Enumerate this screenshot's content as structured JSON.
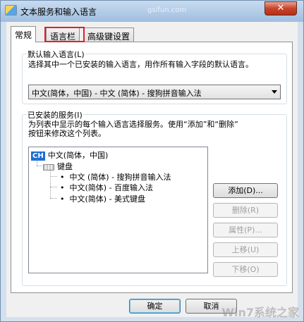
{
  "window": {
    "title": "文本服务和输入语言",
    "watermark_top": "gsifun.com",
    "close_symbol": "✕"
  },
  "tabs": [
    {
      "label": "常规",
      "active": true
    },
    {
      "label": "语言栏",
      "active": false,
      "highlighted": true
    },
    {
      "label": "高级键设置",
      "active": false
    }
  ],
  "default_language": {
    "title": "默认输入语言(L)",
    "description": "选择其中一个已安装的输入语言，用作所有输入字段的默认语言。",
    "selected": "中文(简体，中国) - 中文 (简体) - 搜狗拼音输入法"
  },
  "installed_services": {
    "title": "已安装的服务(I)",
    "description_line1": "为列表中显示的每个输入语言选择服务。使用“添加”和“删除”",
    "description_line2": "按钮来修改这个列表。",
    "language_badge": "CH",
    "language": "中文(简体，中国)",
    "category": "键盘",
    "items": [
      "中文 (简体) - 搜狗拼音输入法",
      "中文(简体) - 百度输入法",
      "中文(简体) - 美式键盘"
    ],
    "bullet": "•"
  },
  "side_buttons": {
    "add": "添加(D)...",
    "remove": "删除(R)",
    "properties": "属性(P)...",
    "move_up": "上移(U)",
    "move_down": "下移(O)"
  },
  "footer": {
    "ok": "确定",
    "cancel": "取消"
  },
  "watermark": "Win7系统之家"
}
